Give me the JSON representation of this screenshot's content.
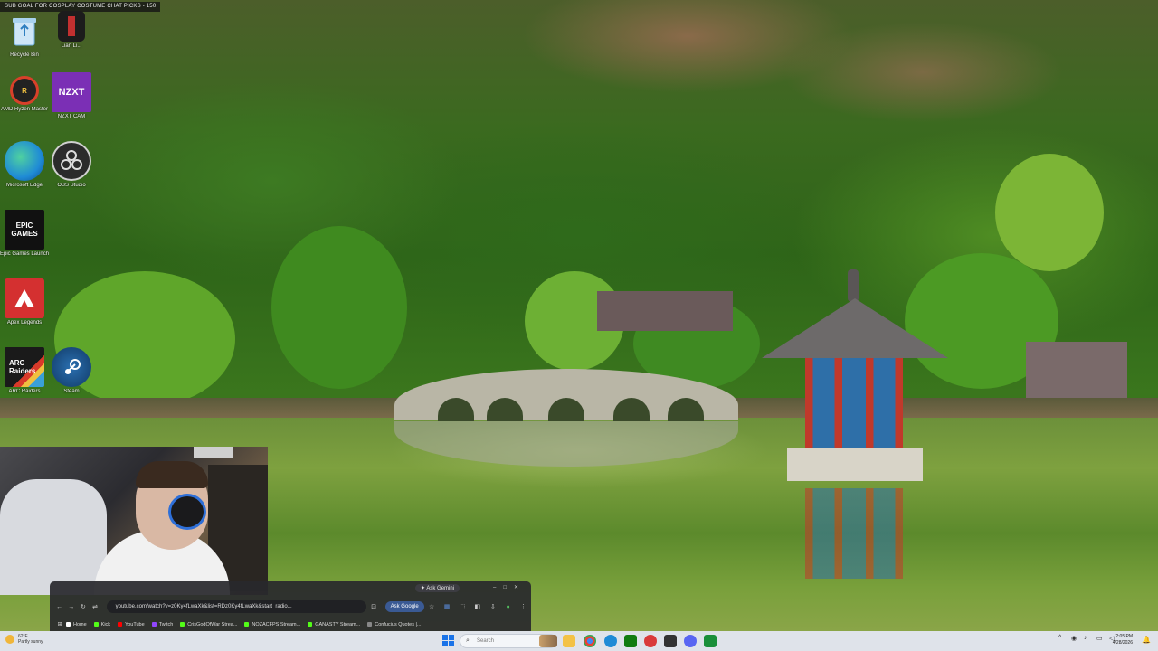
{
  "banner": {
    "text": "SUB GOAL FOR COSPLAY COSTUME CHAT PICKS - 150"
  },
  "desktop_icons": [
    {
      "label": "Recycle Bin",
      "icon": "recycle-bin-icon",
      "color": "#6fb0e0"
    },
    {
      "label": "Lian Li...",
      "icon": "lian-li-icon",
      "color": "#1c1c1c"
    },
    {
      "label": "AMD Ryzen Master",
      "icon": "amd-ryzen-master-icon",
      "color": "#222222"
    },
    {
      "label": "NZXT CAM",
      "icon": "nzxt-cam-icon",
      "color": "#7b2fb5",
      "text": "NZXT"
    },
    {
      "label": "Microsoft Edge",
      "icon": "edge-icon",
      "color": "#1f8bd6"
    },
    {
      "label": "OBS Studio",
      "icon": "obs-studio-icon",
      "color": "#2b2b2b"
    },
    {
      "label": "Epic Games Launcher",
      "icon": "epic-games-icon",
      "color": "#111111",
      "text": "EPIC GAMES"
    },
    {
      "label": "Apex Legends",
      "icon": "apex-legends-icon",
      "color": "#d43030"
    },
    {
      "label": "ARC Raiders",
      "icon": "arc-raiders-icon",
      "color": "#1a1a1a",
      "text": "ARC Raiders"
    },
    {
      "label": "Steam",
      "icon": "steam-icon",
      "color": "#1b4f8a"
    }
  ],
  "browser": {
    "ask_gemini": "Ask Gemini",
    "url": "youtube.com/watch?v=z0Ky4fLwaXk&list=RDz0Ky4fLwaXk&start_radio...",
    "ask_google": "Ask Google",
    "bookmarks": [
      {
        "label": "Home",
        "color": "#ffffff"
      },
      {
        "label": "Kick",
        "color": "#53fc18"
      },
      {
        "label": "YouTube",
        "color": "#ff0000"
      },
      {
        "label": "Twitch",
        "color": "#9146ff"
      },
      {
        "label": "CrisGodOfWar Strea...",
        "color": "#53fc18"
      },
      {
        "label": "NOZACFPS Stream...",
        "color": "#53fc18"
      },
      {
        "label": "GANASTY Stream...",
        "color": "#53fc18"
      },
      {
        "label": "Confucius Quotes |...",
        "color": "#888888"
      }
    ]
  },
  "taskbar": {
    "weather_temp": "62°F",
    "weather_desc": "Partly sunny",
    "search_placeholder": "Search",
    "time": "2:05 PM",
    "date": "4/28/2026",
    "apps": [
      {
        "name": "file-explorer-icon",
        "color": "#f3c246"
      },
      {
        "name": "terminal-icon",
        "color": "#2b2b2b"
      },
      {
        "name": "chrome-icon",
        "color": "#4285f4"
      },
      {
        "name": "edge-taskbar-icon",
        "color": "#1f8bd6"
      },
      {
        "name": "xbox-icon",
        "color": "#107c10"
      },
      {
        "name": "streamerbot-icon",
        "color": "#d93a3a"
      },
      {
        "name": "obs-taskbar-icon",
        "color": "#333333"
      },
      {
        "name": "discord-icon",
        "color": "#5865f2"
      },
      {
        "name": "app-green-icon",
        "color": "#1a8f3a"
      }
    ]
  }
}
